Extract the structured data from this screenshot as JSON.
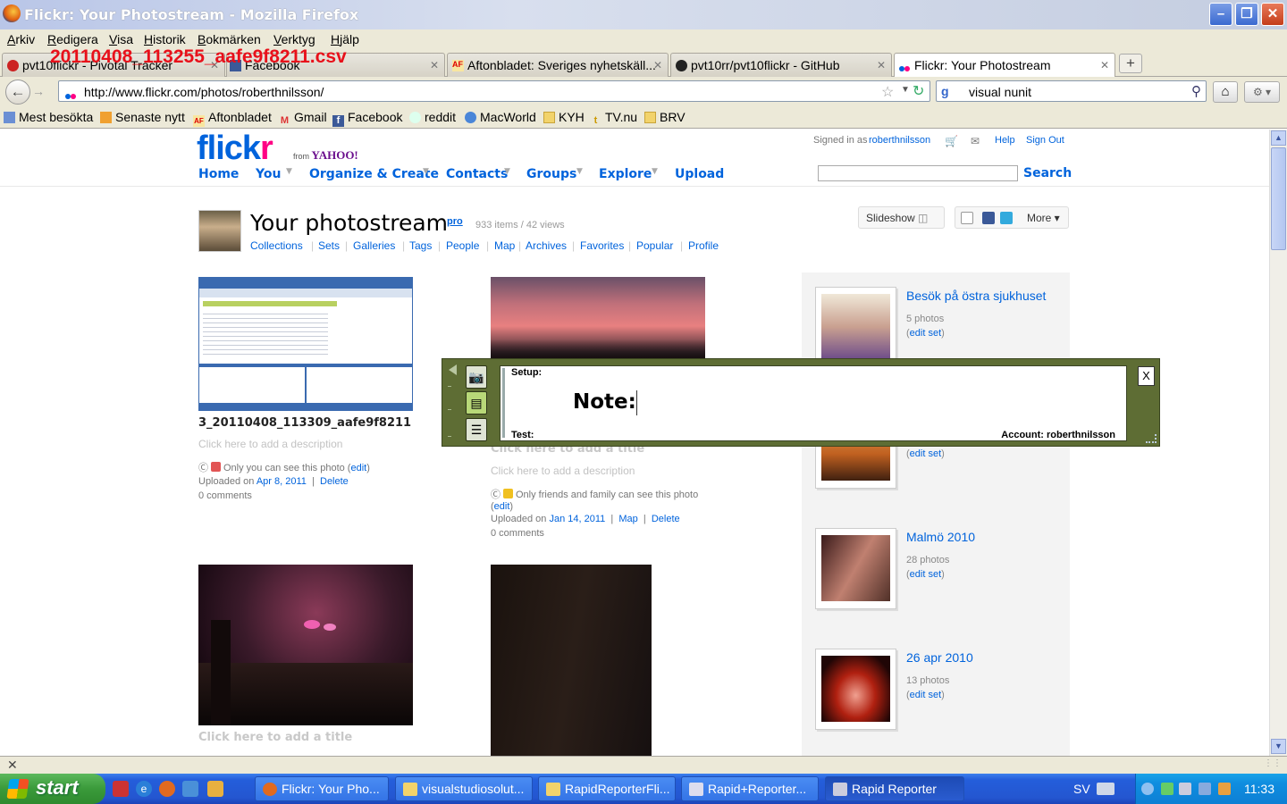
{
  "window": {
    "title": "Flickr: Your Photostream - Mozilla Firefox"
  },
  "menu": [
    "Arkiv",
    "Redigera",
    "Visa",
    "Historik",
    "Bokmärken",
    "Verktyg",
    "Hjälp"
  ],
  "overlay_filename": "20110408_113255_aafe9f8211.csv",
  "tabs": [
    {
      "label": "pvt10flickr - Pivotal Tracker"
    },
    {
      "label": "Facebook"
    },
    {
      "label": "Aftonbladet: Sveriges nyhetskäll..."
    },
    {
      "label": "pvt10rr/pvt10flickr - GitHub"
    },
    {
      "label": "Flickr: Your Photostream"
    }
  ],
  "nav": {
    "url": "http://www.flickr.com/photos/roberthnilsson/",
    "search_value": "visual nunit"
  },
  "bookmarks": [
    "Mest besökta",
    "Senaste nytt",
    "Aftonbladet",
    "Gmail",
    "Facebook",
    "reddit",
    "MacWorld",
    "KYH",
    "TV.nu",
    "BRV"
  ],
  "flickr": {
    "logo_a": "flick",
    "logo_b": "r",
    "from": "from",
    "yahoo": "YAHOO!",
    "signed_in_prefix": "Signed in as",
    "username": "roberthnilsson",
    "help": "Help",
    "sign_out": "Sign Out",
    "nav": [
      "Home",
      "You",
      "Organize & Create",
      "Contacts",
      "Groups",
      "Explore",
      "Upload"
    ],
    "search_btn": "Search",
    "page_title": "Your photostream",
    "pro": "pro",
    "stats": "933 items / 42 views",
    "subnav": [
      "Collections",
      "Sets",
      "Galleries",
      "Tags",
      "People",
      "Map",
      "Archives",
      "Favorites",
      "Popular",
      "Profile"
    ],
    "slideshow": "Slideshow",
    "more": "More"
  },
  "photos": [
    {
      "title": "3_20110408_113309_aafe9f8211",
      "desc": "Click here to add a description",
      "privacy": "Only you can see this photo",
      "edit": "edit",
      "uploaded_prefix": "Uploaded on",
      "date": "Apr 8, 2011",
      "delete": "Delete",
      "comments": "0 comments"
    },
    {
      "title": "Click here to add a title",
      "desc": "Click here to add a description",
      "privacy": "Only friends and family can see this photo",
      "edit": "edit",
      "uploaded_prefix": "Uploaded on",
      "date": "Jan 14, 2011",
      "map": "Map",
      "delete": "Delete",
      "comments": "0 comments"
    },
    {
      "title": "Click here to add a title"
    }
  ],
  "sets": [
    {
      "title": "Besök på östra sjukhuset",
      "count": "5 photos",
      "edit": "edit set"
    },
    {
      "title": "",
      "count": "",
      "edit": "edit set"
    },
    {
      "title": "Malmö 2010",
      "count": "28 photos",
      "edit": "edit set"
    },
    {
      "title": "26 apr 2010",
      "count": "13 photos",
      "edit": "edit set"
    }
  ],
  "rapid_reporter": {
    "setup": "Setup:",
    "note_label": "Note:",
    "test": "Test:",
    "account": "Account: roberthnilsson",
    "close": "X"
  },
  "taskbar": {
    "start": "start",
    "buttons": [
      "Flickr: Your Pho...",
      "visualstudiosolut...",
      "RapidReporterFli...",
      "Rapid+Reporter...",
      "Rapid Reporter"
    ],
    "lang": "SV",
    "clock": "11:33"
  }
}
